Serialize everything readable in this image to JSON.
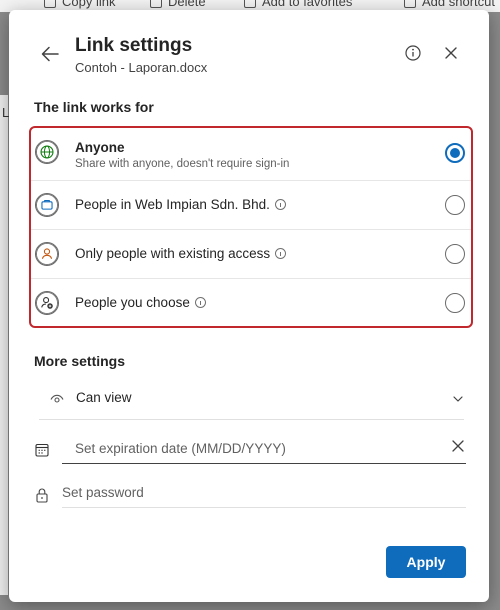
{
  "background": {
    "toolbar_items": [
      {
        "label": "Copy link",
        "icon": "link-icon"
      },
      {
        "label": "Delete",
        "icon": "trash-icon"
      },
      {
        "label": "Add to favorites",
        "icon": "star-icon"
      },
      {
        "label": "Add shortcut",
        "icon": "shortcut-icon"
      }
    ],
    "side_letter": "L"
  },
  "dialog": {
    "title": "Link settings",
    "subtitle": "Contoh - Laporan.docx",
    "link_works_for_label": "The link works for",
    "options": [
      {
        "label": "Anyone",
        "description": "Share with anyone, doesn't require sign-in",
        "icon": "globe-icon",
        "selected": true,
        "info": false
      },
      {
        "label": "People in Web Impian Sdn. Bhd.",
        "icon": "briefcase-icon",
        "selected": false,
        "info": true
      },
      {
        "label": "Only people with existing access",
        "icon": "person-icon",
        "selected": false,
        "info": true
      },
      {
        "label": "People you choose",
        "icon": "person-add-icon",
        "selected": false,
        "info": true
      }
    ],
    "more_settings_label": "More settings",
    "permission": {
      "value": "Can view",
      "icon": "eye-icon"
    },
    "expiration": {
      "placeholder": "Set expiration date (MM/DD/YYYY)",
      "value": ""
    },
    "password": {
      "placeholder": "Set password",
      "value": ""
    },
    "apply_label": "Apply"
  },
  "colors": {
    "accent": "#0f6cbd",
    "highlight_border": "#c0282d"
  }
}
